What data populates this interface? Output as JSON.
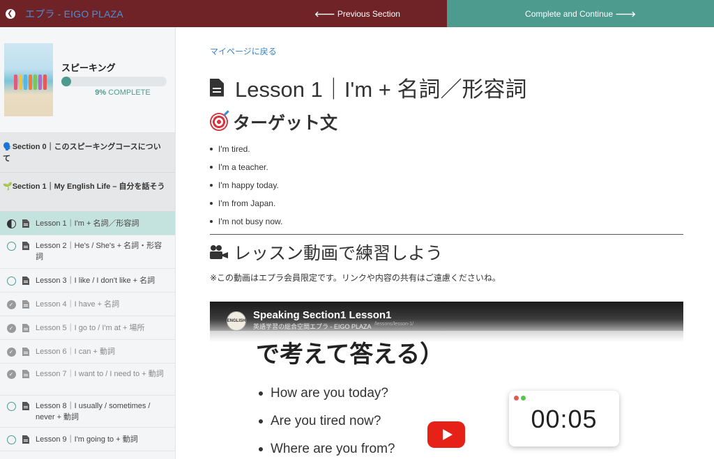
{
  "topbar": {
    "site_title": "エプラ - EIGO PLAZA",
    "prev_label": "Previous Section",
    "next_label": "Complete and Continue"
  },
  "course": {
    "title": "スピーキング",
    "progress_percent": 9,
    "progress_value": "9%",
    "progress_label": "COMPLETE"
  },
  "sections": [
    {
      "icon": "🗣️",
      "title": "Section 0｜このスピーキングコースについて"
    },
    {
      "icon": "🌱",
      "title": "Section 1｜My English Life – 自分を話そう"
    }
  ],
  "lessons": [
    {
      "title": "Lesson 1｜I'm + 名詞／形容詞",
      "status": "in-progress"
    },
    {
      "title": "Lesson 2｜He's / She's + 名詞・形容詞",
      "status": "not-started"
    },
    {
      "title": "Lesson 3｜I like / I don't like + 名詞",
      "status": "not-started"
    },
    {
      "title": "Lesson 4｜I have + 名詞",
      "status": "completed"
    },
    {
      "title": "Lesson 5｜I go to / I'm at + 場所",
      "status": "completed"
    },
    {
      "title": "Lesson 6｜I can + 動詞",
      "status": "completed"
    },
    {
      "title": "Lesson 7｜I want to / I need to + 動詞",
      "status": "completed"
    },
    {
      "title": "Lesson 8｜I usually / sometimes / never + 動詞",
      "status": "not-started"
    },
    {
      "title": "Lesson 9｜I'm going to + 動詞",
      "status": "not-started"
    }
  ],
  "main": {
    "back_link": "マイページに戻る",
    "lesson_title": "Lesson 1｜I'm + 名詞／形容詞",
    "target_heading": "ターゲット文",
    "target_sentences": [
      "I'm tired.",
      "I'm a teacher.",
      "I'm happy today.",
      "I'm from Japan.",
      "I'm not busy now."
    ],
    "video_heading": "レッスン動画で練習しよう",
    "video_note": "※この動画はエプラ会員限定です。リンクや内容の共有はご遠慮くださいね。"
  },
  "video": {
    "title": "Speaking Section1 Lesson1",
    "channel": "英語学習の総合空間エプラ - EIGO PLAZA",
    "url_fragment": "/lessons/lesson-1/",
    "slide_heading": "で考えて答える）",
    "slide_questions": [
      "How are you today?",
      "Are you tired now?",
      "Where are you from?"
    ],
    "timer": "00:05",
    "avatar_text": "ENGLISH"
  },
  "colors": {
    "topbar_bg": "#702326",
    "accent_teal": "#4d9a8f",
    "link_blue": "#3a85c6",
    "active_lesson_bg": "#c5e3de"
  }
}
